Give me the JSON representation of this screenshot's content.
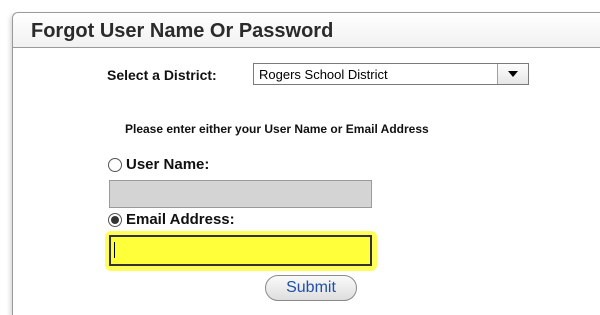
{
  "header": {
    "title": "Forgot User Name Or Password"
  },
  "district": {
    "label": "Select a District:",
    "selected": "Rogers School District"
  },
  "instructions": "Please enter either your User Name or Email Address",
  "username": {
    "label": "User Name:",
    "value": "",
    "checked": false
  },
  "email": {
    "label": "Email Address:",
    "value": "",
    "checked": true
  },
  "submit_label": "Submit",
  "colors": {
    "highlight": "#ffff3a",
    "submit_text": "#1f4fa8"
  }
}
